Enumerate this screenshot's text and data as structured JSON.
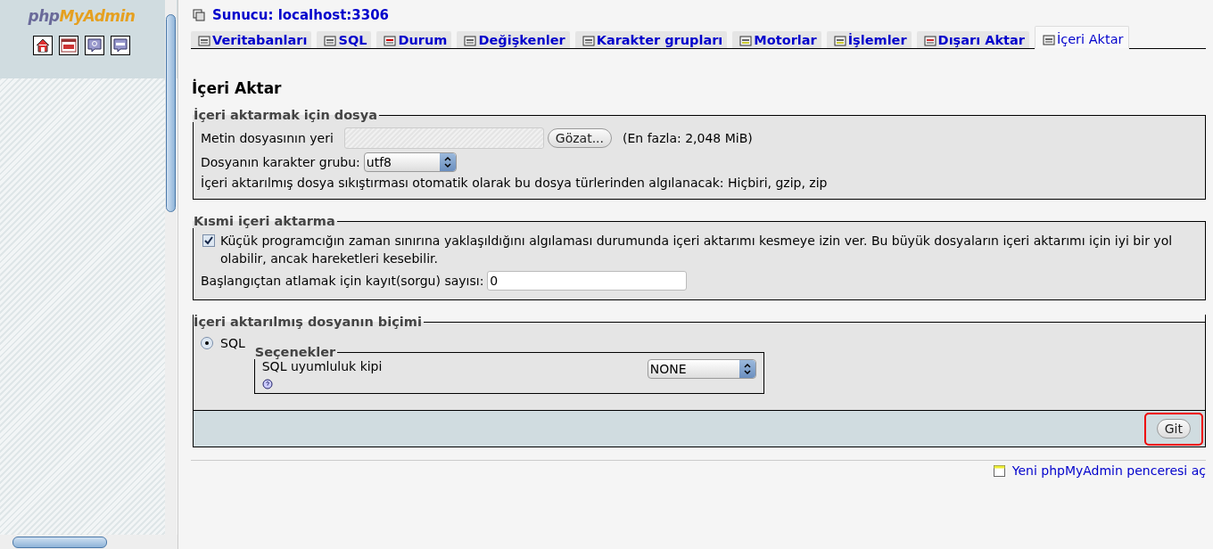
{
  "sidebar": {
    "logo": {
      "part_1": "php",
      "part_2": "MyAdmin"
    }
  },
  "server": {
    "label": "Sunucu: localhost:3306"
  },
  "tabs": [
    {
      "label": "Veritabanları",
      "selected": false
    },
    {
      "label": "SQL",
      "selected": false
    },
    {
      "label": "Durum",
      "selected": false
    },
    {
      "label": "Değişkenler",
      "selected": false
    },
    {
      "label": "Karakter grupları",
      "selected": false
    },
    {
      "label": "Motorlar",
      "selected": false
    },
    {
      "label": "İşlemler",
      "selected": false
    },
    {
      "label": "Dışarı Aktar",
      "selected": false
    },
    {
      "label": "İçeri Aktar",
      "selected": true
    }
  ],
  "page_title": "İçeri Aktar",
  "file_section": {
    "legend": "İçeri aktarmak için dosya",
    "file_label": "Metin dosyasının yeri",
    "browse_button": "Gözat...",
    "max_size": "(En fazla: 2,048 MiB)",
    "charset_label": "Dosyanın karakter grubu:",
    "charset_value": "utf8",
    "compression_note": "İçeri aktarılmış dosya sıkıştırması otomatik olarak bu dosya türlerinden algılanacak: Hiçbiri, gzip, zip"
  },
  "partial_section": {
    "legend": "Kısmi içeri aktarma",
    "allow_interrupt": {
      "label": "Küçük programcığın zaman sınırına yaklaşıldığını algılaması durumunda içeri aktarımı kesmeye izin ver. Bu büyük dosyaların içeri aktarımı için iyi bir yol olabilir, ancak hareketleri kesebilir.",
      "checked": true
    },
    "skip_label": "Başlangıçtan atlamak için kayıt(sorgu) sayısı:",
    "skip_value": "0"
  },
  "format_section": {
    "legend": "İçeri aktarılmış dosyanın biçimi",
    "formats": [
      {
        "label": "SQL",
        "selected": true
      }
    ],
    "options": {
      "legend": "Seçenekler",
      "compat_label": "SQL uyumluluk kipi",
      "compat_value": "NONE"
    }
  },
  "go_button": {
    "label": "Git",
    "highlighted": true
  },
  "new_window_link": "Yeni phpMyAdmin penceresi aç"
}
